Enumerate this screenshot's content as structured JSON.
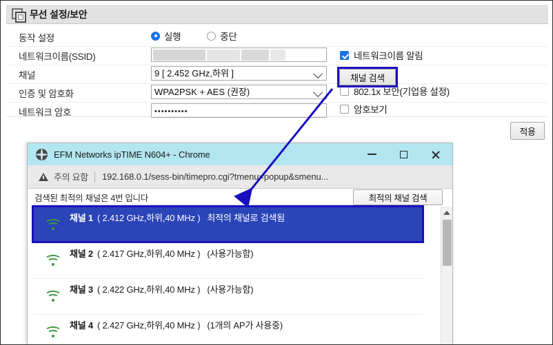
{
  "panel": {
    "title": "무선 설정/보안",
    "icon": "window-copy-icon",
    "rows": [
      {
        "label": "동작 설정"
      },
      {
        "label": "네트워크이름(SSID)"
      },
      {
        "label": "채널"
      },
      {
        "label": "인증 및 암호화"
      },
      {
        "label": "네트워크 암호"
      }
    ],
    "operation": {
      "option_run": "실행",
      "option_stop": "중단",
      "selected": "실행"
    },
    "ssid": {
      "value": "",
      "redacted": true
    },
    "channel": {
      "value": "9 [ 2.452 GHz,하위 ]"
    },
    "encryption": {
      "value": "WPA2PSK + AES (권장)"
    },
    "password": {
      "value": "••••••••••"
    },
    "checkboxes": [
      {
        "label": "네트워크이름 알림",
        "checked": true
      },
      {
        "label": "802.1x 보안(기업용 설정)",
        "checked": false
      },
      {
        "label": "암호보기",
        "checked": false
      }
    ],
    "scan_button": "채널 검색",
    "apply_button": "적용",
    "highlight_color": "#1a0fc0",
    "accent_color": "#1a73e8"
  },
  "popup": {
    "title": "EFM Networks ipTIME N604+  - Chrome",
    "title_icon": "globe-icon",
    "window_buttons": {
      "minimize": "minimize-icon",
      "maximize": "maximize-icon",
      "close": "close-icon"
    },
    "omnibox": {
      "warning_icon": "warning-triangle-icon",
      "warning_text": "주의 요함",
      "url": "192.168.0.1/sess-bin/timepro.cgi?tmenu=popup&smenu..."
    },
    "note": "검색된 최적의 채널은 4번 입니다",
    "best_channel_button": "최적의 채널 검색",
    "channels": [
      {
        "name": "채널 1",
        "freq": "( 2.412 GHz,하위,40 MHz )",
        "status": "최적의 채널로 검색됨",
        "selected": true,
        "icon": "wifi-icon"
      },
      {
        "name": "채널 2",
        "freq": "( 2.417 GHz,하위,40 MHz )",
        "status": "(사용가능함)",
        "selected": false,
        "icon": "wifi-icon"
      },
      {
        "name": "채널 3",
        "freq": "( 2.422 GHz,하위,40 MHz )",
        "status": "(사용가능함)",
        "selected": false,
        "icon": "wifi-icon"
      },
      {
        "name": "채널 4",
        "freq": "( 2.427 GHz,하위,40 MHz )",
        "status": "(1개의 AP가 사용중)",
        "selected": false,
        "icon": "wifi-icon"
      }
    ],
    "scrollbar": {
      "up_arrow": "scroll-up-icon"
    },
    "titlebar_color": "#b2e6f0",
    "selection_color": "#2b44b8"
  },
  "annotation": {
    "arrow_color": "#1a0fc0",
    "from": "채널 검색",
    "to": "popup"
  }
}
